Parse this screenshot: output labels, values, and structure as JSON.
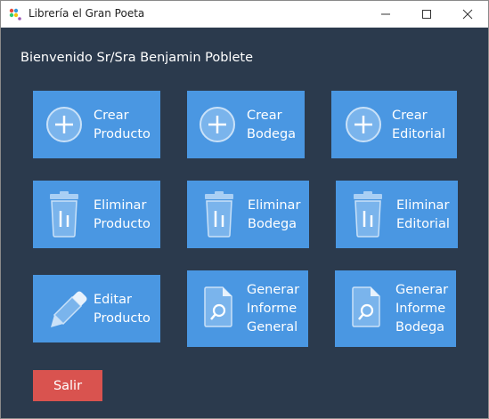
{
  "window": {
    "title": "Librería el Gran Poeta",
    "controls": {
      "minimize": "minimize-icon",
      "maximize": "maximize-icon",
      "close": "close-icon"
    }
  },
  "welcome": "Bienvenido Sr/Sra Benjamin Poblete",
  "tiles": {
    "crear_producto": {
      "line1": "Crear",
      "line2": "Producto"
    },
    "crear_bodega": {
      "line1": "Crear",
      "line2": "Bodega"
    },
    "crear_editorial": {
      "line1": "Crear",
      "line2": "Editorial"
    },
    "eliminar_producto": {
      "line1": "Eliminar",
      "line2": "Producto"
    },
    "eliminar_bodega": {
      "line1": "Eliminar",
      "line2": "Bodega"
    },
    "eliminar_editorial": {
      "line1": "Eliminar",
      "line2": "Editorial"
    },
    "editar_producto": {
      "line1": "Editar",
      "line2": "Producto"
    },
    "informe_general": {
      "line1": "Generar",
      "line2": "Informe",
      "line3": "General"
    },
    "informe_bodega": {
      "line1": "Generar",
      "line2": "Informe",
      "line3": "Bodega"
    }
  },
  "exit_label": "Salir",
  "colors": {
    "background": "#2b3a4d",
    "tile": "#4a97e2",
    "exit": "#d9534f"
  }
}
